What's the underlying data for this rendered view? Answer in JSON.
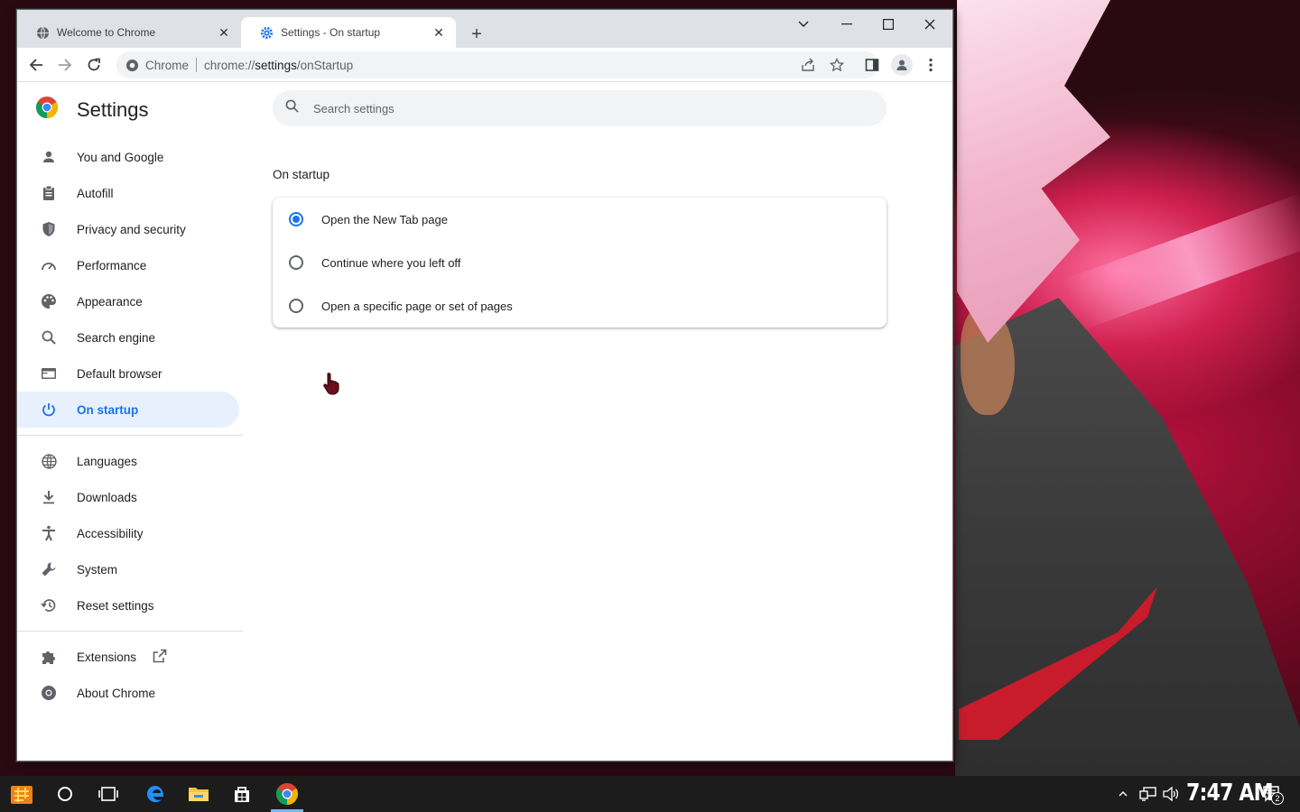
{
  "tabs": [
    {
      "title": "Welcome to Chrome",
      "icon": "globe-icon"
    },
    {
      "title": "Settings - On startup",
      "icon": "gear-icon"
    }
  ],
  "omnibox": {
    "chip": "Chrome",
    "url_scheme": "chrome://",
    "url_host": "settings",
    "url_path": "/onStartup"
  },
  "settings": {
    "title": "Settings",
    "search_placeholder": "Search settings",
    "nav_primary": [
      {
        "label": "You and Google",
        "icon": "person-icon"
      },
      {
        "label": "Autofill",
        "icon": "clipboard-icon"
      },
      {
        "label": "Privacy and security",
        "icon": "shield-icon"
      },
      {
        "label": "Performance",
        "icon": "speedometer-icon"
      },
      {
        "label": "Appearance",
        "icon": "palette-icon"
      },
      {
        "label": "Search engine",
        "icon": "search-icon"
      },
      {
        "label": "Default browser",
        "icon": "browser-icon"
      },
      {
        "label": "On startup",
        "icon": "power-icon"
      }
    ],
    "nav_secondary": [
      {
        "label": "Languages",
        "icon": "globe-icon"
      },
      {
        "label": "Downloads",
        "icon": "download-icon"
      },
      {
        "label": "Accessibility",
        "icon": "accessibility-icon"
      },
      {
        "label": "System",
        "icon": "wrench-icon"
      },
      {
        "label": "Reset settings",
        "icon": "history-icon"
      }
    ],
    "nav_tertiary": [
      {
        "label": "Extensions",
        "icon": "puzzle-icon"
      },
      {
        "label": "About Chrome",
        "icon": "chrome-icon"
      }
    ],
    "section_title": "On startup",
    "options": [
      {
        "label": "Open the New Tab page",
        "selected": true
      },
      {
        "label": "Continue where you left off",
        "selected": false
      },
      {
        "label": "Open a specific page or set of pages",
        "selected": false
      }
    ]
  },
  "taskbar": {
    "clock": "7:47 AM",
    "notification_count": "2"
  },
  "colors": {
    "accent": "#1a73e8",
    "active_nav_bg": "#e8f0fe",
    "titlebar": "#dee1e6"
  }
}
